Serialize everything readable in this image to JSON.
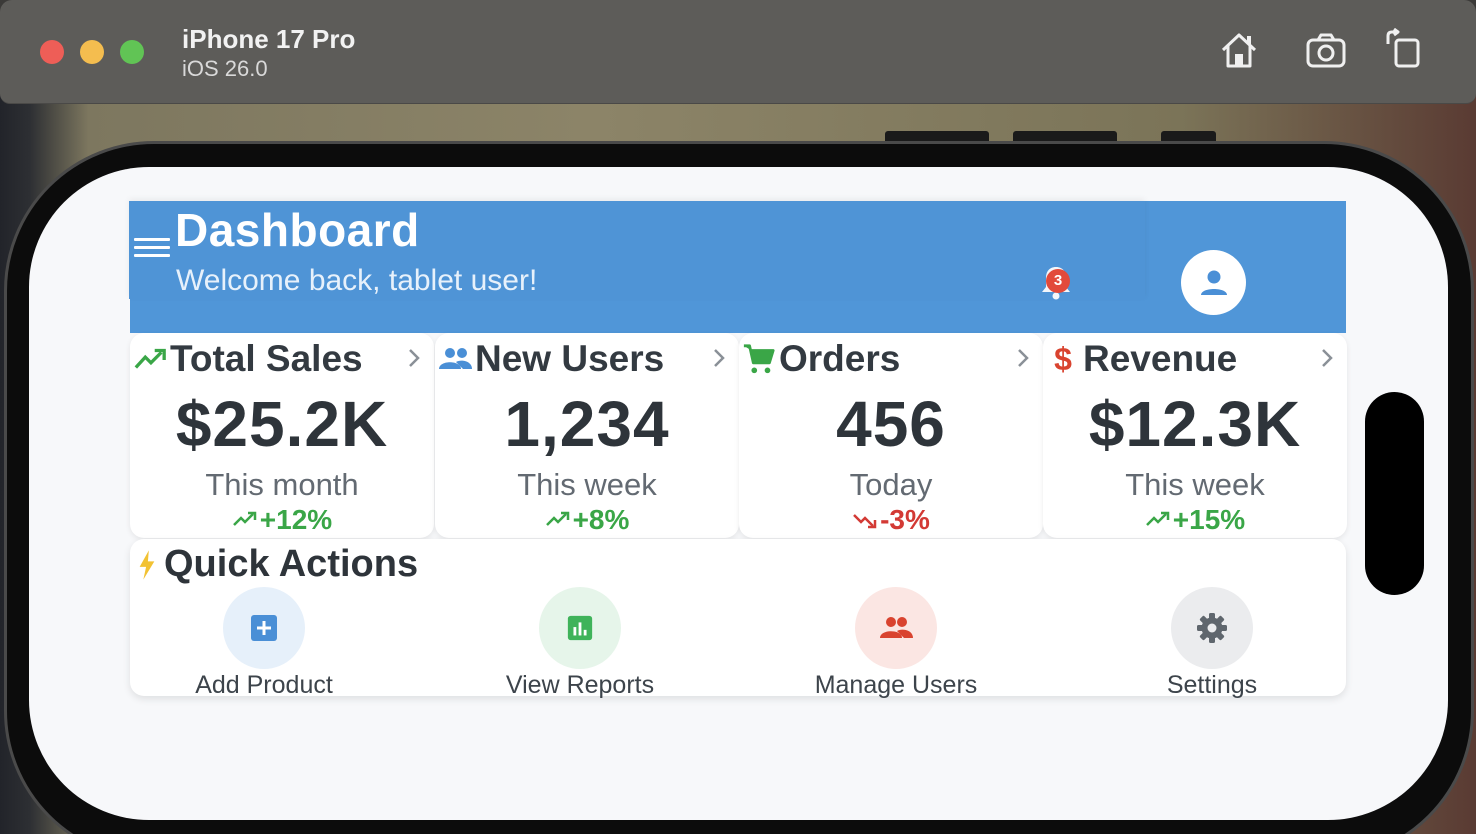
{
  "window": {
    "device_name": "iPhone 17 Pro",
    "os_version": "iOS 26.0",
    "icons": [
      "home-icon",
      "screenshot-icon",
      "rotate-icon"
    ]
  },
  "header": {
    "title": "Dashboard",
    "subtitle": "Welcome back, tablet user!",
    "notification_count": "3",
    "accent_color": "#5096d8"
  },
  "stats": [
    {
      "title": "Total Sales",
      "icon": "trending-up-icon",
      "icon_color": "#3aa647",
      "value": "$25.2K",
      "period": "This month",
      "change": "+12%",
      "trend": "up"
    },
    {
      "title": "New Users",
      "icon": "people-icon",
      "icon_color": "#4a8fd6",
      "value": "1,234",
      "period": "This week",
      "change": "+8%",
      "trend": "up"
    },
    {
      "title": "Orders",
      "icon": "cart-icon",
      "icon_color": "#3aa647",
      "value": "456",
      "period": "Today",
      "change": "-3%",
      "trend": "down"
    },
    {
      "title": "Revenue",
      "icon": "dollar-icon",
      "icon_color": "#d9432f",
      "value": "$12.3K",
      "period": "This week",
      "change": "+15%",
      "trend": "up"
    }
  ],
  "quick_actions": {
    "title": "Quick Actions",
    "items": [
      {
        "label": "Add Product",
        "icon": "add-box-icon",
        "color": "#4a8fd6",
        "bg": "#e6f0fa"
      },
      {
        "label": "View Reports",
        "icon": "bar-chart-icon",
        "color": "#3fb35a",
        "bg": "#e6f5ea"
      },
      {
        "label": "Manage Users",
        "icon": "people-icon",
        "color": "#d9432f",
        "bg": "#fbe6e3"
      },
      {
        "label": "Settings",
        "icon": "gear-icon",
        "color": "#5f666d",
        "bg": "#ebecee"
      }
    ]
  }
}
